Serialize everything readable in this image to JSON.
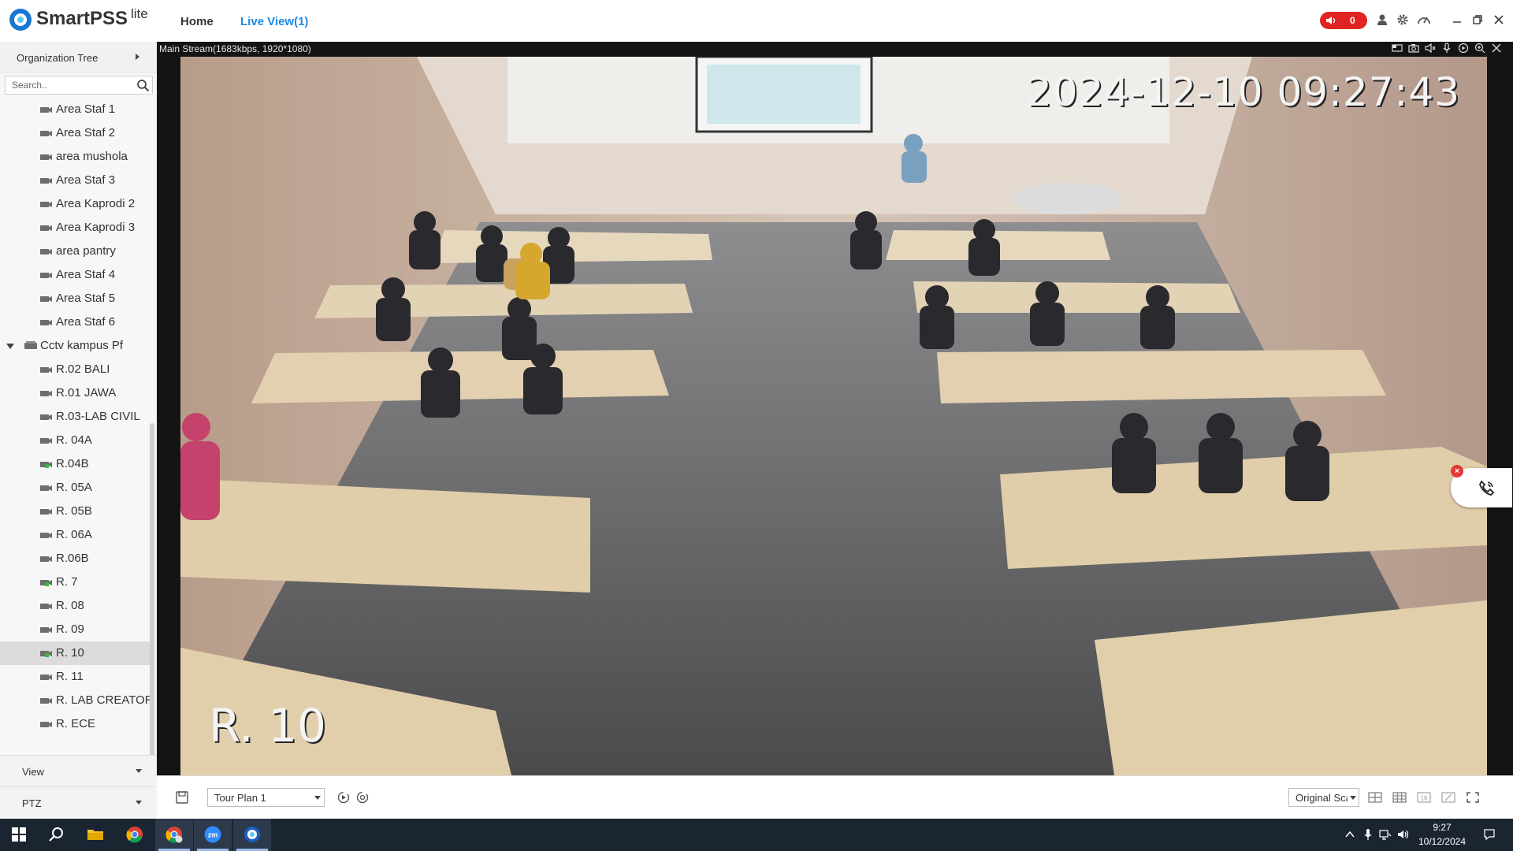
{
  "app": {
    "brand": "SmartPSS",
    "brand_suffix": "lite",
    "tabs": [
      {
        "label": "Home"
      },
      {
        "label": "Live View(1)"
      }
    ],
    "alarm_count": "0",
    "accent": "#1e88e5",
    "alarm_color": "#e02424",
    "toolbar_icons": [
      "user-icon",
      "settings-icon",
      "performance-icon",
      "minimize-icon",
      "restore-icon",
      "close-icon"
    ]
  },
  "sidebar": {
    "title": "Organization Tree",
    "search_placeholder": "Search..",
    "items": [
      {
        "label": "Area Staf 1",
        "online": false
      },
      {
        "label": "Area Staf 2",
        "online": false
      },
      {
        "label": "area mushola",
        "online": false
      },
      {
        "label": "Area Staf 3",
        "online": false
      },
      {
        "label": "Area Kaprodi 2",
        "online": false
      },
      {
        "label": "Area Kaprodi 3",
        "online": false
      },
      {
        "label": "area pantry",
        "online": false
      },
      {
        "label": "Area Staf 4",
        "online": false
      },
      {
        "label": "Area Staf 5",
        "online": false
      },
      {
        "label": "Area Staf 6",
        "online": false
      }
    ],
    "group": {
      "label": "Cctv kampus Pf",
      "expanded": true
    },
    "group_items": [
      {
        "label": "R.02 BALI",
        "online": false
      },
      {
        "label": "R.01 JAWA",
        "online": false
      },
      {
        "label": "R.03-LAB CIVIL",
        "online": false
      },
      {
        "label": "R. 04A",
        "online": false
      },
      {
        "label": "R.04B",
        "online": true
      },
      {
        "label": "R. 05A",
        "online": false
      },
      {
        "label": "R. 05B",
        "online": false
      },
      {
        "label": "R. 06A",
        "online": false
      },
      {
        "label": "R.06B",
        "online": false
      },
      {
        "label": "R. 7",
        "online": true
      },
      {
        "label": "R. 08",
        "online": false
      },
      {
        "label": "R. 09",
        "online": false
      },
      {
        "label": "R. 10",
        "online": true,
        "selected": true
      },
      {
        "label": "R. 11",
        "online": false
      },
      {
        "label": "R. LAB CREATOR",
        "online": false
      },
      {
        "label": "R. ECE",
        "online": false
      }
    ],
    "sections": [
      {
        "label": "View"
      },
      {
        "label": "PTZ"
      }
    ]
  },
  "video": {
    "stream_info": "Main Stream(1683kbps, 1920*1080)",
    "timestamp": "2024-12-10 09:27:43",
    "camera_overlay": "R. 10",
    "tile_icons": [
      "window-icon",
      "snapshot-icon",
      "audio-icon",
      "microphone-icon",
      "record-icon",
      "zoom-icon",
      "close-icon"
    ]
  },
  "bottombar": {
    "tour_plan": "Tour Plan 1",
    "scale": "Original Scale",
    "layout_label": "16"
  },
  "taskbar": {
    "apps": [
      "windows-start-icon",
      "search-icon",
      "file-explorer-icon",
      "chrome-icon",
      "chrome-profile-icon",
      "zoom-icon",
      "smartpss-icon"
    ],
    "time": "9:27",
    "date": "10/12/2024"
  }
}
